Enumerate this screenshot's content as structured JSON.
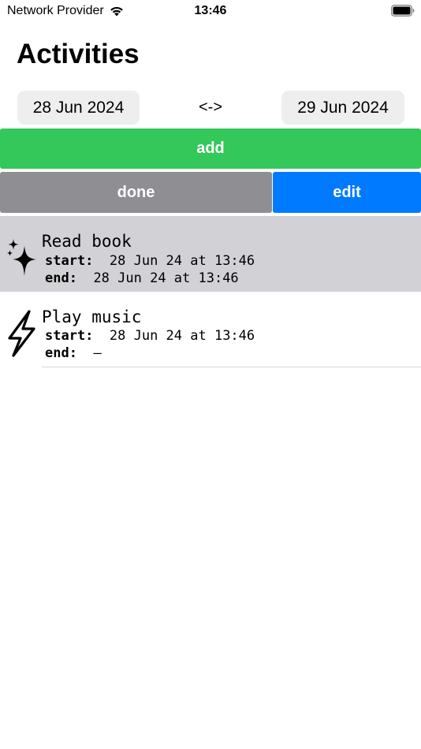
{
  "status_bar": {
    "carrier": "Network Provider",
    "time": "13:46",
    "wifi_icon": "wifi-icon",
    "battery_icon": "battery-icon"
  },
  "page": {
    "title": "Activities"
  },
  "date_range": {
    "start": "28 Jun 2024",
    "separator": "<->",
    "end": "29 Jun 2024"
  },
  "buttons": {
    "add": "add",
    "done": "done",
    "edit": "edit",
    "colors": {
      "add": "#34c759",
      "done": "#8e8e93",
      "edit": "#007aff"
    }
  },
  "activities": [
    {
      "title": "Read book",
      "icon": "sparkles-icon",
      "start_label": "start:",
      "start": "28 Jun 24 at 13:46",
      "end_label": "end:",
      "end": "28 Jun 24 at 13:46",
      "selected": true
    },
    {
      "title": "Play music",
      "icon": "bolt-icon",
      "start_label": "start:",
      "start": "28 Jun 24 at 13:46",
      "end_label": "end:",
      "end": "–",
      "selected": false
    }
  ]
}
